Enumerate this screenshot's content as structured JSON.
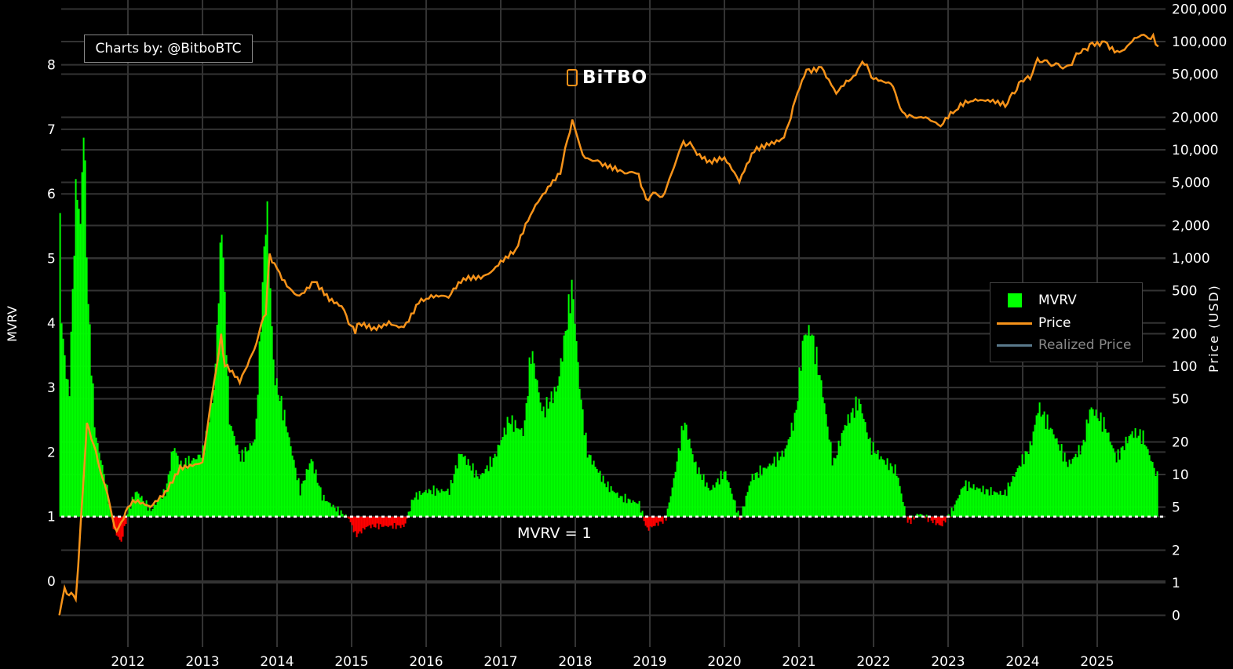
{
  "header": {
    "credit": "Charts by: @BitboBTC",
    "logo_text": "BiTBO"
  },
  "annotation": "MVRV = 1",
  "colors": {
    "mvrv_above": "#00ff00",
    "mvrv_below": "#ff0000",
    "price": "#f7931a",
    "realized_price": "#5a7a8c",
    "grid": "#333333"
  },
  "chart_data": {
    "type": "bar+line",
    "title": "",
    "xlabel": "",
    "ylabel_left": "MVRV",
    "ylabel_right": "Price (USD)",
    "x_ticks": [
      "2012",
      "2013",
      "2014",
      "2015",
      "2016",
      "2017",
      "2018",
      "2019",
      "2020",
      "2021",
      "2022",
      "2023",
      "2024",
      "2025"
    ],
    "x_range": [
      2011.08,
      2025.85
    ],
    "left_ticks": [
      "0",
      "1",
      "2",
      "3",
      "4",
      "5",
      "6",
      "7",
      "8"
    ],
    "left_range": [
      -0.5,
      9
    ],
    "right_scale": "log",
    "right_ticks": [
      {
        "label": "200,000",
        "value": 200000
      },
      {
        "label": "100,000",
        "value": 100000
      },
      {
        "label": "50,000",
        "value": 50000
      },
      {
        "label": "20,000",
        "value": 20000
      },
      {
        "label": "10,000",
        "value": 10000
      },
      {
        "label": "5,000",
        "value": 5000
      },
      {
        "label": "2,000",
        "value": 2000
      },
      {
        "label": "1,000",
        "value": 1000
      },
      {
        "label": "500",
        "value": 500
      },
      {
        "label": "200",
        "value": 200
      },
      {
        "label": "100",
        "value": 100
      },
      {
        "label": "50",
        "value": 50
      },
      {
        "label": "20",
        "value": 20
      },
      {
        "label": "10",
        "value": 10
      },
      {
        "label": "5",
        "value": 5
      },
      {
        "label": "2",
        "value": 2
      },
      {
        "label": "1",
        "value": 1
      },
      {
        "label": "0",
        "value": 0.5
      }
    ],
    "reference_line": {
      "value": 1,
      "label": "MVRV = 1"
    },
    "legend": {
      "placement": "right",
      "entries": [
        "MVRV",
        "Price",
        "Realized Price"
      ]
    },
    "series": [
      {
        "name": "MVRV",
        "type": "bar",
        "x": [
          2011.08,
          2011.1,
          2011.2,
          2011.3,
          2011.35,
          2011.4,
          2011.45,
          2011.55,
          2011.7,
          2011.8,
          2011.9,
          2012.0,
          2012.1,
          2012.3,
          2012.5,
          2012.6,
          2012.7,
          2012.9,
          2013.0,
          2013.15,
          2013.25,
          2013.35,
          2013.5,
          2013.7,
          2013.85,
          2013.95,
          2014.1,
          2014.3,
          2014.45,
          2014.6,
          2014.8,
          2014.95,
          2015.05,
          2015.2,
          2015.5,
          2015.7,
          2015.82,
          2016.0,
          2016.3,
          2016.45,
          2016.7,
          2016.9,
          2017.1,
          2017.3,
          2017.4,
          2017.55,
          2017.75,
          2017.95,
          2018.05,
          2018.15,
          2018.4,
          2018.6,
          2018.85,
          2018.95,
          2019.2,
          2019.3,
          2019.45,
          2019.6,
          2019.8,
          2020.0,
          2020.2,
          2020.35,
          2020.6,
          2020.8,
          2020.95,
          2021.05,
          2021.15,
          2021.3,
          2021.45,
          2021.6,
          2021.8,
          2021.95,
          2022.1,
          2022.3,
          2022.45,
          2022.6,
          2022.75,
          2022.9,
          2023.05,
          2023.2,
          2023.5,
          2023.75,
          2023.95,
          2024.1,
          2024.2,
          2024.4,
          2024.6,
          2024.8,
          2024.9,
          2025.1,
          2025.25,
          2025.45,
          2025.6,
          2025.8
        ],
        "values": [
          5.8,
          4.0,
          2.8,
          6.3,
          5.4,
          7.2,
          4.5,
          2.3,
          1.5,
          0.8,
          0.6,
          1.1,
          1.4,
          1.1,
          1.4,
          2.1,
          1.8,
          1.9,
          2.0,
          3.0,
          5.6,
          2.5,
          1.9,
          2.2,
          5.9,
          3.2,
          2.5,
          1.4,
          1.9,
          1.3,
          1.1,
          0.98,
          0.7,
          0.85,
          0.85,
          0.85,
          1.3,
          1.4,
          1.4,
          2.0,
          1.6,
          1.9,
          2.5,
          2.3,
          3.6,
          2.6,
          3.0,
          4.6,
          3.0,
          2.0,
          1.5,
          1.3,
          1.2,
          0.8,
          0.95,
          1.5,
          2.5,
          1.8,
          1.4,
          1.7,
          0.95,
          1.6,
          1.8,
          2.0,
          2.6,
          3.8,
          3.9,
          3.0,
          1.8,
          2.4,
          2.8,
          2.1,
          1.9,
          1.7,
          0.9,
          1.05,
          0.95,
          0.85,
          1.1,
          1.5,
          1.4,
          1.35,
          1.8,
          2.1,
          2.7,
          2.3,
          1.8,
          2.1,
          2.7,
          2.4,
          1.9,
          2.3,
          2.25,
          1.6
        ]
      },
      {
        "name": "Price",
        "type": "line",
        "x": [
          2011.08,
          2011.15,
          2011.3,
          2011.4,
          2011.45,
          2011.6,
          2011.85,
          2012.0,
          2012.1,
          2012.3,
          2012.5,
          2012.7,
          2013.0,
          2013.25,
          2013.3,
          2013.5,
          2013.6,
          2013.85,
          2013.9,
          2014.0,
          2014.2,
          2014.3,
          2014.5,
          2014.7,
          2014.9,
          2015.05,
          2015.1,
          2015.3,
          2015.5,
          2015.7,
          2015.9,
          2016.0,
          2016.3,
          2016.5,
          2016.8,
          2017.0,
          2017.2,
          2017.4,
          2017.6,
          2017.8,
          2017.96,
          2018.1,
          2018.3,
          2018.6,
          2018.85,
          2018.95,
          2019.2,
          2019.45,
          2019.6,
          2019.8,
          2020.0,
          2020.2,
          2020.4,
          2020.6,
          2020.8,
          2020.95,
          2021.1,
          2021.3,
          2021.5,
          2021.7,
          2021.85,
          2022.0,
          2022.2,
          2022.45,
          2022.7,
          2022.9,
          2023.1,
          2023.3,
          2023.6,
          2023.8,
          2023.95,
          2024.1,
          2024.2,
          2024.6,
          2024.9,
          2025.1,
          2025.3,
          2025.5,
          2025.75,
          2025.82
        ],
        "values": [
          0.5,
          0.9,
          0.7,
          8,
          30,
          13,
          3,
          5,
          5.5,
          5,
          7,
          12,
          13,
          200,
          100,
          70,
          100,
          300,
          1100,
          800,
          500,
          450,
          600,
          400,
          330,
          200,
          250,
          230,
          260,
          230,
          380,
          420,
          430,
          650,
          700,
          950,
          1200,
          2500,
          4000,
          6000,
          19000,
          9000,
          8000,
          6500,
          6000,
          3500,
          4000,
          12000,
          10000,
          8000,
          8500,
          5000,
          9500,
          11000,
          13000,
          29000,
          55000,
          58000,
          33000,
          45000,
          65000,
          45000,
          42000,
          20000,
          20000,
          16500,
          23000,
          28000,
          29000,
          27000,
          42000,
          45000,
          70000,
          60000,
          95000,
          100000,
          80000,
          108000,
          115000,
          90000
        ]
      }
    ]
  }
}
